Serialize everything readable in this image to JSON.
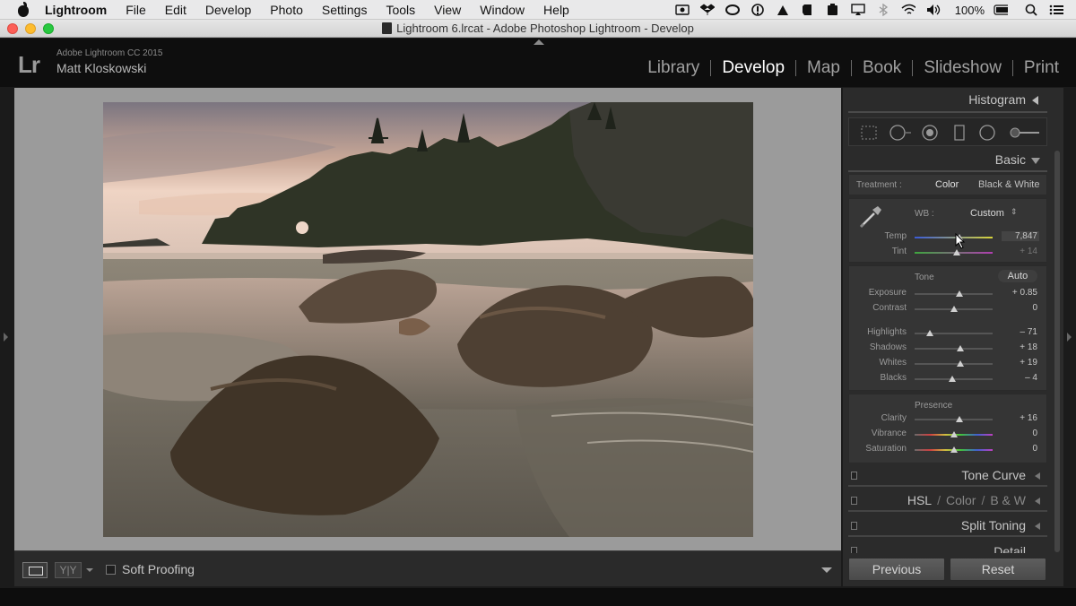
{
  "menubar": {
    "app_name": "Lightroom",
    "items": [
      "File",
      "Edit",
      "Develop",
      "Photo",
      "Settings",
      "Tools",
      "View",
      "Window",
      "Help"
    ],
    "battery": "100%"
  },
  "window": {
    "title": "Lightroom 6.lrcat - Adobe Photoshop Lightroom - Develop"
  },
  "identity": {
    "logo": "Lr",
    "version": "Adobe Lightroom CC 2015",
    "user": "Matt Kloskowski"
  },
  "modules": [
    {
      "label": "Library",
      "active": false
    },
    {
      "label": "Develop",
      "active": true
    },
    {
      "label": "Map",
      "active": false
    },
    {
      "label": "Book",
      "active": false
    },
    {
      "label": "Slideshow",
      "active": false
    },
    {
      "label": "Print",
      "active": false
    }
  ],
  "right_panel": {
    "histogram_title": "Histogram",
    "basic_title": "Basic",
    "treatment": {
      "label": "Treatment :",
      "color": "Color",
      "bw": "Black & White"
    },
    "wb": {
      "label": "WB :",
      "value": "Custom"
    },
    "temp": {
      "label": "Temp",
      "value": "7,847",
      "level": 0.58
    },
    "tint": {
      "label": "Tint",
      "value": "+ 14",
      "level": 0.54
    },
    "tone_label": "Tone",
    "auto_label": "Auto",
    "tone_sliders": [
      {
        "label": "Exposure",
        "value": "+ 0.85",
        "level": 0.57
      },
      {
        "label": "Contrast",
        "value": "0",
        "level": 0.5
      }
    ],
    "hs_sliders": [
      {
        "label": "Highlights",
        "value": "– 71",
        "level": 0.19
      },
      {
        "label": "Shadows",
        "value": "+ 18",
        "level": 0.59
      },
      {
        "label": "Whites",
        "value": "+ 19",
        "level": 0.59
      },
      {
        "label": "Blacks",
        "value": "– 4",
        "level": 0.48
      }
    ],
    "presence_label": "Presence",
    "presence_sliders": [
      {
        "label": "Clarity",
        "value": "+ 16",
        "level": 0.58
      },
      {
        "label": "Vibrance",
        "value": "0",
        "level": 0.5
      },
      {
        "label": "Saturation",
        "value": "0",
        "level": 0.5
      }
    ],
    "tone_curve_title": "Tone Curve",
    "hsl_title": "HSL",
    "hsl_color": "Color",
    "hsl_bw": "B & W",
    "split_toning_title": "Split Toning",
    "detail_title": "Detail",
    "previous_label": "Previous",
    "reset_label": "Reset"
  },
  "toolbar": {
    "yy_label": "Y|Y",
    "soft_proofing_label": "Soft Proofing"
  },
  "colors": {
    "accent_temp_start": "#3a5bd8",
    "accent_temp_end": "#d8d43a",
    "tint_start": "#3ea63e",
    "tint_end": "#b03eb0"
  }
}
